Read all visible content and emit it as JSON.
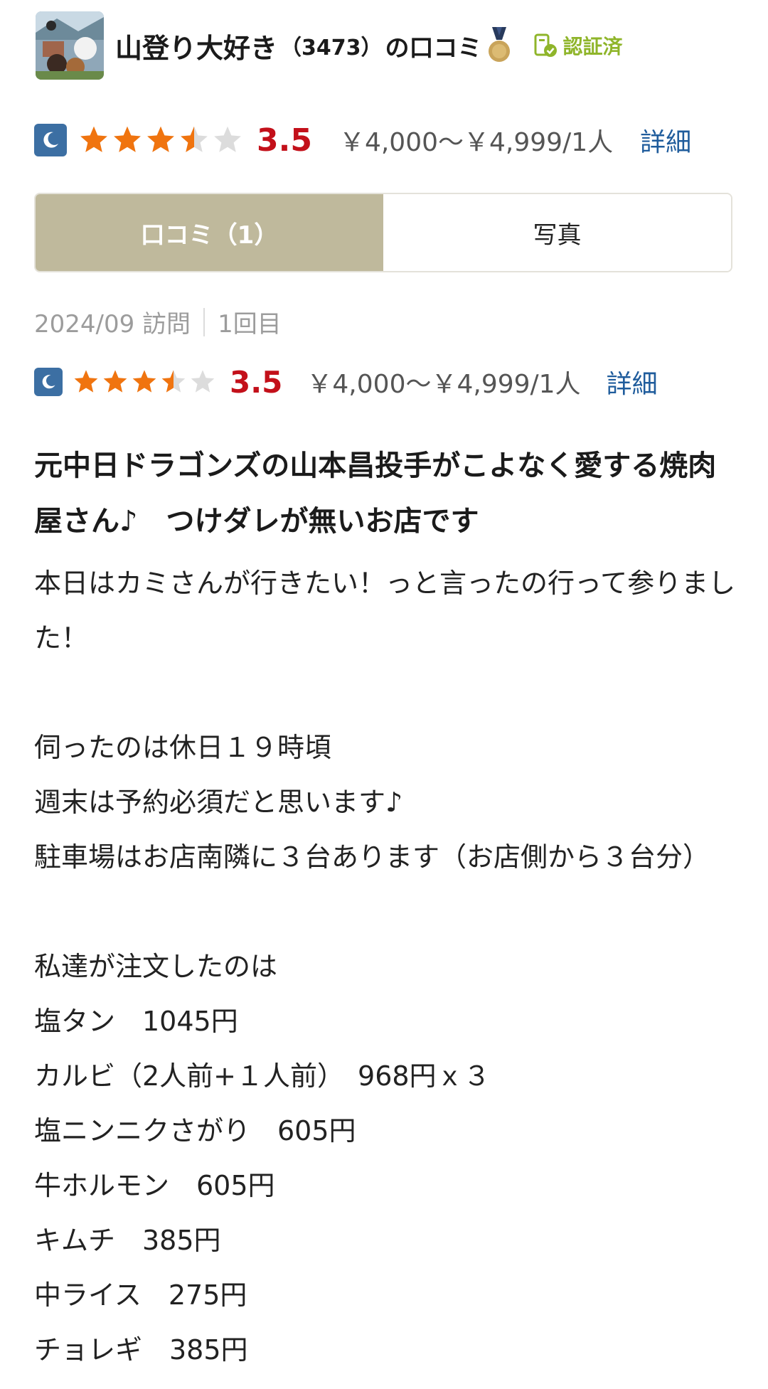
{
  "header": {
    "reviewer_name": "山登り大好き",
    "review_count": "（3473）",
    "suffix": "の口コミ",
    "verified_label": "認証済"
  },
  "summary_rating": {
    "score": "3.5",
    "stars": 3.5,
    "price": "￥4,000～￥4,999/1人",
    "detail_link": "詳細"
  },
  "tabs": [
    {
      "label": "口コミ（1）",
      "active": true
    },
    {
      "label": "写真",
      "active": false
    }
  ],
  "visit": {
    "date": "2024/09 訪問",
    "count": "1回目"
  },
  "review_rating": {
    "score": "3.5",
    "stars": 3.5,
    "price": "￥4,000～￥4,999/1人",
    "detail_link": "詳細"
  },
  "review": {
    "title": "元中日ドラゴンズの山本昌投手がこよなく愛する焼肉屋さん♪　つけダレが無いお店です",
    "lines": [
      "本日はカミさんが行きたい！っと言ったの行って参りました！",
      "",
      "伺ったのは休日１９時頃",
      "週末は予約必須だと思います♪",
      "駐車場はお店南隣に３台あります（お店側から３台分）",
      "",
      "私達が注文したのは",
      "塩タン　1045円",
      "カルビ（2人前+１人前）　968円ｘ３",
      "塩ニンニクさがり　605円",
      "牛ホルモン　605円",
      "キムチ　385円",
      "中ライス　275円",
      "チョレギ　385円"
    ]
  },
  "colors": {
    "score": "#c3101a",
    "star": "#f0740f",
    "tab_active": "#bfb99c",
    "link": "#1f5c9c",
    "verified": "#8fb52a",
    "moon_badge": "#3c6fa3"
  }
}
